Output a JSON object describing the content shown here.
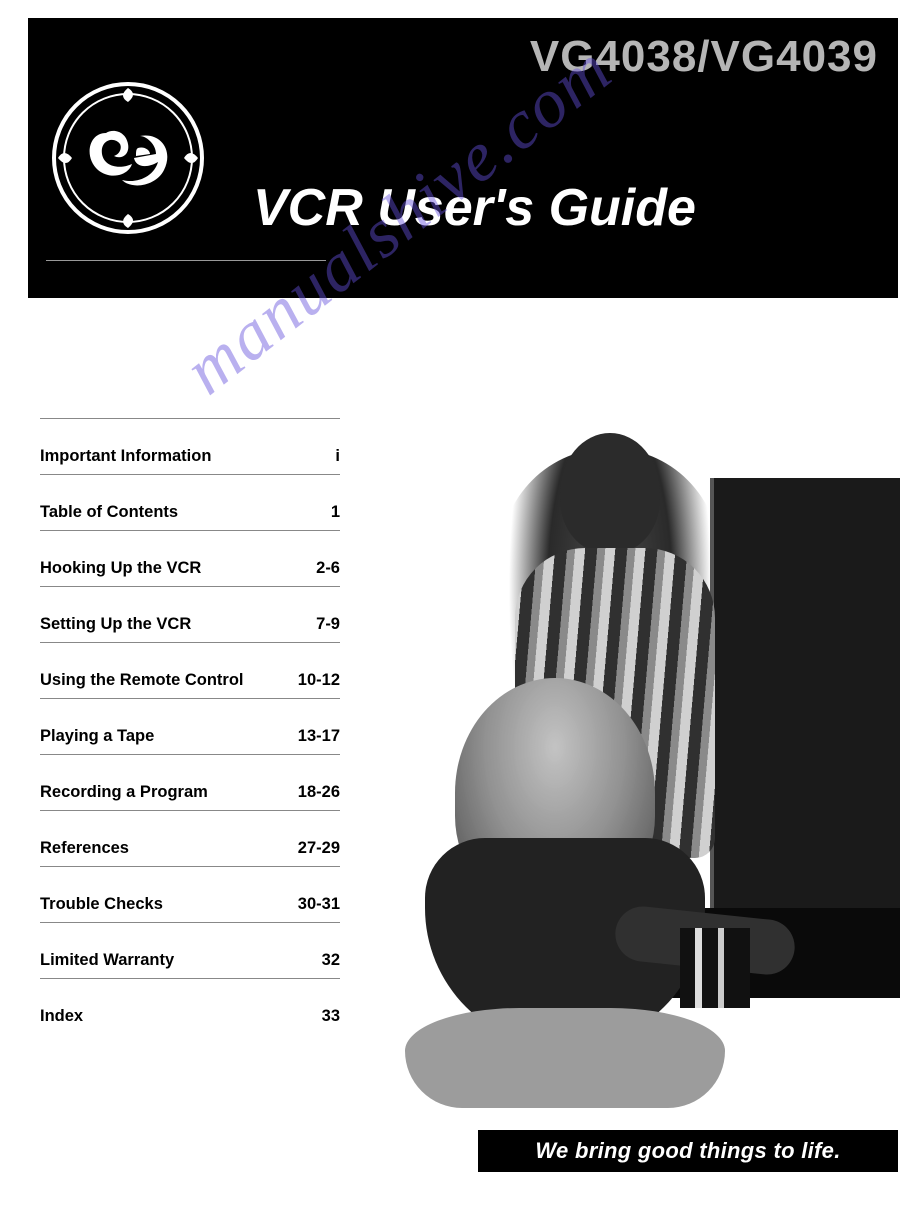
{
  "header": {
    "model_number": "VG4038/VG4039",
    "title": "VCR User's Guide"
  },
  "toc": [
    {
      "label": "Important Information",
      "pages": "i"
    },
    {
      "label": "Table of Contents",
      "pages": "1"
    },
    {
      "label": "Hooking Up the VCR",
      "pages": "2-6"
    },
    {
      "label": "Setting Up the VCR",
      "pages": "7-9"
    },
    {
      "label": "Using the Remote Control",
      "pages": "10-12"
    },
    {
      "label": "Playing a Tape",
      "pages": "13-17"
    },
    {
      "label": "Recording a Program",
      "pages": "18-26"
    },
    {
      "label": "References",
      "pages": "27-29"
    },
    {
      "label": "Trouble Checks",
      "pages": "30-31"
    },
    {
      "label": "Limited Warranty",
      "pages": "32"
    },
    {
      "label": "Index",
      "pages": "33"
    }
  ],
  "tagline": "We bring good things to life.",
  "watermark": "manualshive.com",
  "image_description": "Black-and-white photo of a man in a vertically striped shirt standing behind a seated woman with long curly hair; she is reaching toward a VCR beneath a large television set, with a stack of VHS tapes nearby."
}
